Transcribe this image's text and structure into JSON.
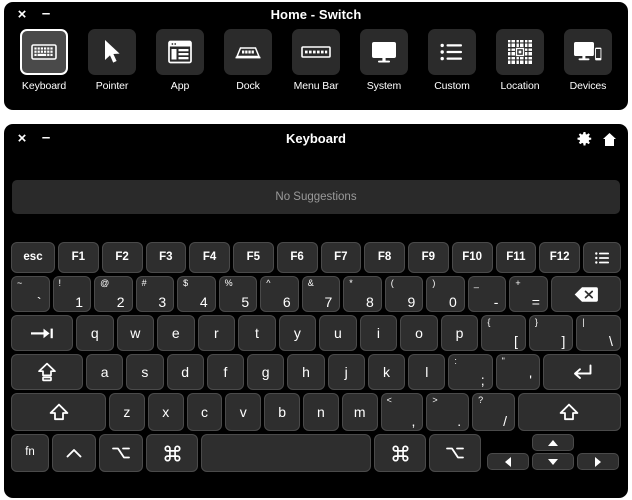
{
  "switch_window": {
    "title": "Home - Switch",
    "close_label": "×",
    "minimize_label": "–",
    "tiles": [
      {
        "label": "Keyboard",
        "icon": "keyboard-icon",
        "selected": true
      },
      {
        "label": "Pointer",
        "icon": "pointer-cursor-icon",
        "selected": false
      },
      {
        "label": "App",
        "icon": "app-window-icon",
        "selected": false
      },
      {
        "label": "Dock",
        "icon": "dock-icon",
        "selected": false
      },
      {
        "label": "Menu Bar",
        "icon": "menu-bar-icon",
        "selected": false
      },
      {
        "label": "System",
        "icon": "display-monitor-icon",
        "selected": false
      },
      {
        "label": "Custom",
        "icon": "list-bullet-icon",
        "selected": false
      },
      {
        "label": "Location",
        "icon": "grid-location-icon",
        "selected": false
      },
      {
        "label": "Devices",
        "icon": "devices-icon",
        "selected": false
      }
    ]
  },
  "keyboard_window": {
    "title": "Keyboard",
    "close_label": "×",
    "minimize_label": "–",
    "gear_icon": "gear-icon",
    "home_icon": "home-icon",
    "suggestions_text": "No Suggestions",
    "rows": {
      "function_row": [
        {
          "name": "esc",
          "main": "esc"
        },
        {
          "name": "f1",
          "main": "F1"
        },
        {
          "name": "f2",
          "main": "F2"
        },
        {
          "name": "f3",
          "main": "F3"
        },
        {
          "name": "f4",
          "main": "F4"
        },
        {
          "name": "f5",
          "main": "F5"
        },
        {
          "name": "f6",
          "main": "F6"
        },
        {
          "name": "f7",
          "main": "F7"
        },
        {
          "name": "f8",
          "main": "F8"
        },
        {
          "name": "f9",
          "main": "F9"
        },
        {
          "name": "f10",
          "main": "F10"
        },
        {
          "name": "f11",
          "main": "F11"
        },
        {
          "name": "f12",
          "main": "F12"
        },
        {
          "name": "menu",
          "main": "",
          "icon": "list-menu-icon"
        }
      ],
      "number_row": [
        {
          "name": "backtick",
          "sup": "~",
          "main": "`"
        },
        {
          "name": "1",
          "sup": "!",
          "main": "1"
        },
        {
          "name": "2",
          "sup": "@",
          "main": "2"
        },
        {
          "name": "3",
          "sup": "#",
          "main": "3"
        },
        {
          "name": "4",
          "sup": "$",
          "main": "4"
        },
        {
          "name": "5",
          "sup": "%",
          "main": "5"
        },
        {
          "name": "6",
          "sup": "^",
          "main": "6"
        },
        {
          "name": "7",
          "sup": "&",
          "main": "7"
        },
        {
          "name": "8",
          "sup": "*",
          "main": "8"
        },
        {
          "name": "9",
          "sup": "(",
          "main": "9"
        },
        {
          "name": "0",
          "sup": ")",
          "main": "0"
        },
        {
          "name": "minus",
          "sup": "_",
          "main": "-"
        },
        {
          "name": "equals",
          "sup": "+",
          "main": "="
        },
        {
          "name": "delete",
          "main": "",
          "icon": "backspace-icon"
        }
      ],
      "qwerty_row": [
        {
          "name": "tab",
          "main": "",
          "icon": "tab-arrow-icon"
        },
        {
          "name": "q",
          "main": "q"
        },
        {
          "name": "w",
          "main": "w"
        },
        {
          "name": "e",
          "main": "e"
        },
        {
          "name": "r",
          "main": "r"
        },
        {
          "name": "t",
          "main": "t"
        },
        {
          "name": "y",
          "main": "y"
        },
        {
          "name": "u",
          "main": "u"
        },
        {
          "name": "i",
          "main": "i"
        },
        {
          "name": "o",
          "main": "o"
        },
        {
          "name": "p",
          "main": "p"
        },
        {
          "name": "bracket-left",
          "sup": "{",
          "main": "["
        },
        {
          "name": "bracket-right",
          "sup": "}",
          "main": "]"
        },
        {
          "name": "backslash",
          "sup": "|",
          "main": "\\"
        }
      ],
      "home_row": [
        {
          "name": "caps-lock",
          "main": "",
          "icon": "caps-lock-icon"
        },
        {
          "name": "a",
          "main": "a"
        },
        {
          "name": "s",
          "main": "s"
        },
        {
          "name": "d",
          "main": "d"
        },
        {
          "name": "f",
          "main": "f"
        },
        {
          "name": "g",
          "main": "g"
        },
        {
          "name": "h",
          "main": "h"
        },
        {
          "name": "j",
          "main": "j"
        },
        {
          "name": "k",
          "main": "k"
        },
        {
          "name": "l",
          "main": "l"
        },
        {
          "name": "semicolon",
          "sup": ":",
          "main": ";"
        },
        {
          "name": "quote",
          "sup": "\"",
          "main": "'"
        },
        {
          "name": "return",
          "main": "",
          "icon": "return-icon"
        }
      ],
      "bottom_letter_row": [
        {
          "name": "shift-left",
          "main": "",
          "icon": "shift-icon"
        },
        {
          "name": "z",
          "main": "z"
        },
        {
          "name": "x",
          "main": "x"
        },
        {
          "name": "c",
          "main": "c"
        },
        {
          "name": "v",
          "main": "v"
        },
        {
          "name": "b",
          "main": "b"
        },
        {
          "name": "n",
          "main": "n"
        },
        {
          "name": "m",
          "main": "m"
        },
        {
          "name": "comma",
          "sup": "<",
          "main": ","
        },
        {
          "name": "period",
          "sup": ">",
          "main": "."
        },
        {
          "name": "slash",
          "sup": "?",
          "main": "/"
        },
        {
          "name": "shift-right",
          "main": "",
          "icon": "shift-icon"
        }
      ],
      "modifier_row": [
        {
          "name": "fn",
          "main": "fn"
        },
        {
          "name": "control-left",
          "main": "˄",
          "icon": "control-icon"
        },
        {
          "name": "option-left",
          "main": "⌥",
          "icon": "option-icon"
        },
        {
          "name": "command-left",
          "main": "⌘",
          "icon": "command-icon"
        },
        {
          "name": "space",
          "main": ""
        },
        {
          "name": "command-right",
          "main": "⌘",
          "icon": "command-icon"
        },
        {
          "name": "option-right",
          "main": "⌥",
          "icon": "option-icon"
        }
      ],
      "arrow_keys": [
        {
          "name": "arrow-up",
          "direction": "up"
        },
        {
          "name": "arrow-left",
          "direction": "left"
        },
        {
          "name": "arrow-down",
          "direction": "down"
        },
        {
          "name": "arrow-right",
          "direction": "right"
        }
      ]
    }
  }
}
